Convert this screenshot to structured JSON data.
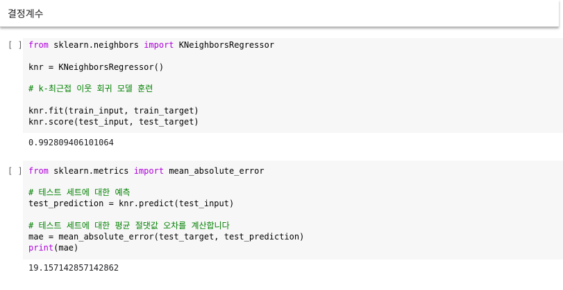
{
  "text_cell": {
    "heading": "결정계수"
  },
  "cells": [
    {
      "run_label": "[ ]",
      "lines": [
        {
          "p1": "from",
          "p2": " sklearn.neighbors ",
          "p3": "import",
          "p4": " KNeighborsRegressor"
        },
        {
          "text": "knr = KNeighborsRegressor()"
        },
        {
          "comment": "# k-최근접 이웃 회귀 모델 훈련"
        },
        {
          "text": "knr.fit(train_input, train_target)"
        },
        {
          "text": "knr.score(test_input, test_target)"
        }
      ],
      "output": "0.992809406101064"
    },
    {
      "run_label": "[ ]",
      "lines": [
        {
          "p1": "from",
          "p2": " sklearn.metrics ",
          "p3": "import",
          "p4": " mean_absolute_error"
        },
        {
          "comment": "# 테스트 세트에 대한 예측"
        },
        {
          "text": "test_prediction = knr.predict(test_input)"
        },
        {
          "comment": "# 테스트 세트에 대한 평균 절댓값 오차를 계산합니다"
        },
        {
          "text": "mae = mean_absolute_error(test_target, test_prediction)"
        },
        {
          "fn": "print",
          "rest": "(mae)"
        }
      ],
      "output": "19.157142857142862"
    }
  ]
}
